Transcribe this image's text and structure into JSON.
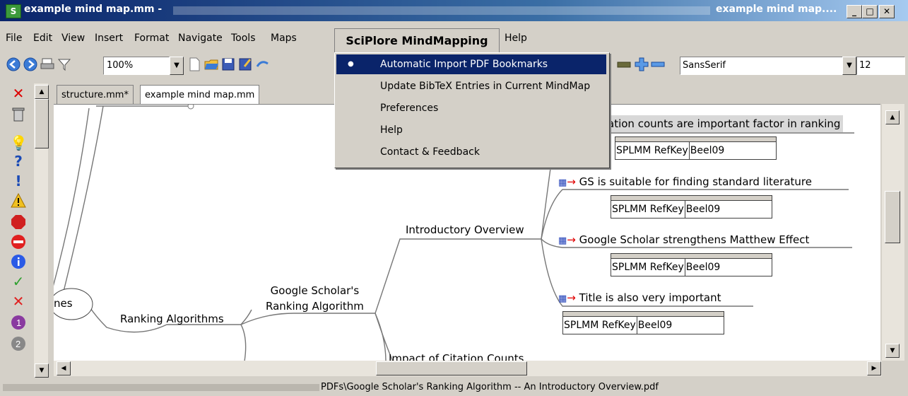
{
  "window": {
    "title_left": "example mind map.mm -",
    "title_right": "example mind map....",
    "app_icon": "S",
    "min_glyph": "_",
    "max_glyph": "□",
    "close_glyph": "✕"
  },
  "menubar": {
    "items": [
      "File",
      "Edit",
      "View",
      "Insert",
      "Format",
      "Navigate",
      "Tools",
      "Maps",
      "SciPlore MindMapping",
      "Help"
    ]
  },
  "toolbar": {
    "zoom": "100%",
    "font": "SansSerif",
    "font_size": "12"
  },
  "tabs": [
    "structure.mm*",
    "example mind map.mm"
  ],
  "dropdown": {
    "items": [
      "Automatic Import PDF Bookmarks",
      "Update BibTeX Entries in Current MindMap",
      "Preferences",
      "Help",
      "Contact & Feedback"
    ],
    "bullet": "●"
  },
  "map": {
    "nodes": {
      "left_partial": "nes",
      "ranking_algorithms": "Ranking Algorithms",
      "gs_ranking_l1": "Google Scholar's",
      "gs_ranking_l2": "Ranking Algorithm",
      "introductory_overview": "Introductory Overview",
      "impact_citation": "Impact of Citation Counts",
      "citation_counts": "ation counts are important factor in ranking",
      "gs_suitable": "GS is suitable for finding standard literature",
      "gs_matthew": "Google Scholar strengthens Matthew Effect",
      "title_important": "Title is also very important"
    },
    "attr_key": "SPLMM RefKey",
    "attr_value": "Beel09"
  },
  "statusbar": {
    "path": "PDFs\\Google Scholar's Ranking Algorithm -- An Introductory Overview.pdf"
  },
  "colors": {
    "menu_highlight": "#0a246a",
    "face": "#d4d0c8"
  }
}
